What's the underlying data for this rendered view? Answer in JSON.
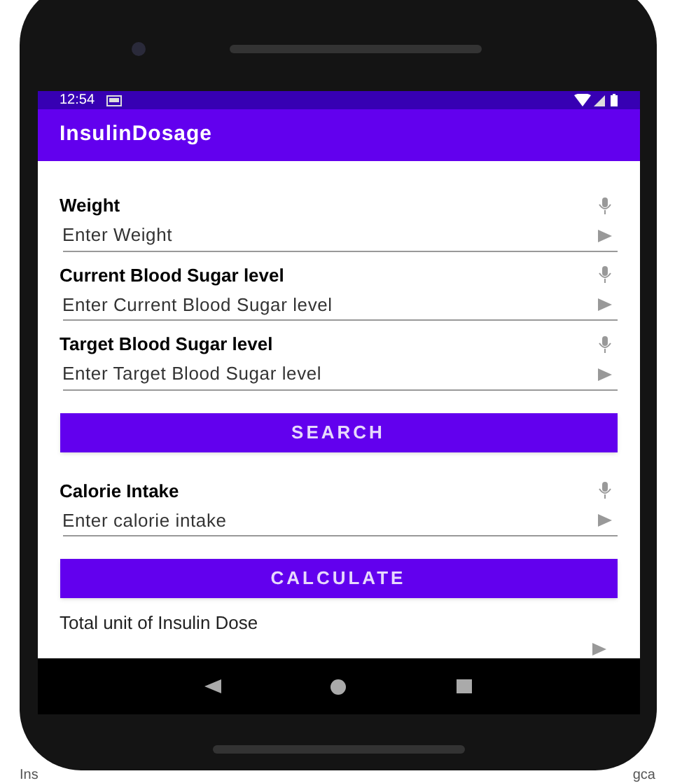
{
  "status_bar": {
    "time": "12:54"
  },
  "app_bar": {
    "title": "InsulinDosage"
  },
  "form": [
    {
      "kind": "field",
      "label": "Weight",
      "placeholder": "Enter Weight"
    },
    {
      "kind": "field",
      "label": "Current Blood Sugar level",
      "placeholder": "Enter Current Blood Sugar level"
    },
    {
      "kind": "field",
      "label": "Target Blood Sugar level",
      "placeholder": "Enter Target Blood Sugar level"
    },
    {
      "kind": "button",
      "label": "SEARCH"
    },
    {
      "kind": "field",
      "label": "Calorie Intake",
      "placeholder": "Enter calorie intake"
    },
    {
      "kind": "button",
      "label": "CALCULATE"
    },
    {
      "kind": "result",
      "label": "Total unit of Insulin Dose"
    }
  ],
  "background_fragments": [
    "Ins",
    "gca"
  ]
}
